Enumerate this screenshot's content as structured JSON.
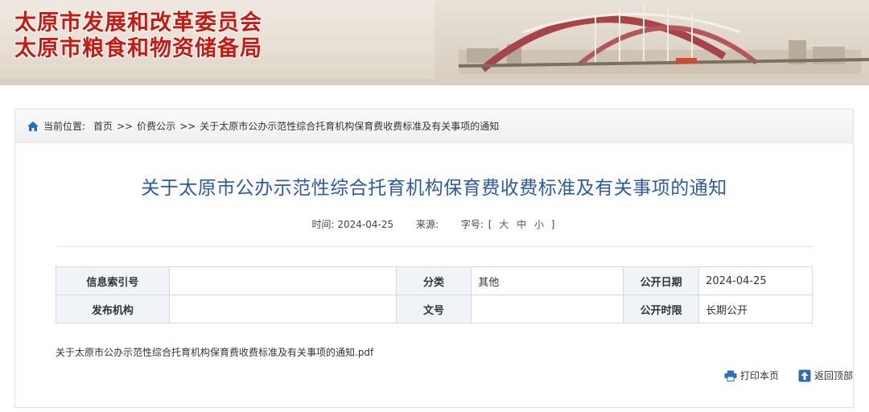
{
  "header": {
    "title_line1": "太原市发展和改革委员会",
    "title_line2": "太原市粮食和物资储备局"
  },
  "breadcrumb": {
    "prefix": "当前位置:",
    "items": [
      "首页",
      "价费公示",
      "关于太原市公办示范性综合托育机构保育费收费标准及有关事项的通知"
    ],
    "separator": ">>"
  },
  "article": {
    "title": "关于太原市公办示范性综合托育机构保育费收费标准及有关事项的通知",
    "time_label": "时间:",
    "time_value": "2024-04-25",
    "source_label": "来源:",
    "source_value": "",
    "fontsize_label": "字号:",
    "fontsize_open": "[",
    "fontsize_large": "大",
    "fontsize_medium": "中",
    "fontsize_small": "小",
    "fontsize_close": "]"
  },
  "info_table": {
    "index_label": "信息索引号",
    "index_value": "",
    "category_label": "分类",
    "category_value": "其他",
    "date_label": "公开日期",
    "date_value": "2024-04-25",
    "publisher_label": "发布机构",
    "publisher_value": "",
    "docno_label": "文号",
    "docno_value": "",
    "period_label": "公开时限",
    "period_value": "长期公开"
  },
  "attachment": {
    "filename": "关于太原市公办示范性综合托育机构保育费收费标准及有关事项的通知.pdf"
  },
  "tools": {
    "print_label": "打印本页",
    "top_label": "返回顶部"
  },
  "colors": {
    "title_red": "#c71a12",
    "article_blue": "#2f5a9e",
    "icon_blue": "#2c6fb6"
  },
  "icons": [
    "home-icon",
    "print-icon",
    "back-to-top-icon"
  ]
}
